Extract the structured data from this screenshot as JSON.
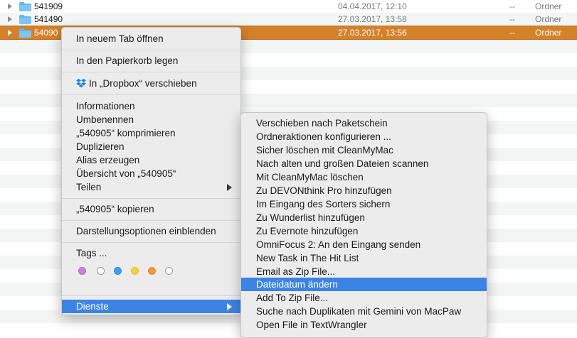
{
  "finder": {
    "rows": [
      {
        "name": "541909",
        "date": "04.04.2017, 12:10",
        "size": "--",
        "kind": "Ordner"
      },
      {
        "name": "541490",
        "date": "27.03.2017, 13:58",
        "size": "--",
        "kind": "Ordner"
      },
      {
        "name": "54090",
        "date": "27.03.2017, 13:56",
        "size": "--",
        "kind": "Ordner"
      }
    ]
  },
  "context_menu": {
    "open_in_tab": "In neuem Tab öffnen",
    "trash": "In den Papierkorb legen",
    "dropbox": "In „Dropbox“ verschieben",
    "info": "Informationen",
    "rename": "Umbenennen",
    "compress": "„540905“ komprimieren",
    "duplicate": "Duplizieren",
    "alias": "Alias erzeugen",
    "overview": "Übersicht von „540905“",
    "share": "Teilen",
    "copy": "„540905“ kopieren",
    "view_options": "Darstellungsoptionen einblenden",
    "tags": "Tags ...",
    "services": "Dienste",
    "tag_colors": [
      "#d07ddf",
      "#ffffff",
      "#3aa2f0",
      "#f8d140",
      "#f69b3b",
      "#ffffff"
    ]
  },
  "services_menu": {
    "items": [
      "Verschieben nach Paketschein",
      "Ordneraktionen konfigurieren ...",
      "Sicher löschen mit CleanMyMac",
      "Nach alten und großen Dateien scannen",
      "Mit CleanMyMac löschen",
      "Zu DEVONthink Pro hinzufügen",
      "Im Eingang des Sorters sichern",
      "Zu Wunderlist hinzufügen",
      "Zu Evernote hinzufügen",
      "OmniFocus 2: An den Eingang senden",
      "New Task in The Hit List",
      "Email as Zip File...",
      "Dateidatum ändern",
      "Add To Zip File...",
      "Suche nach Duplikaten mit Gemini von MacPaw",
      "Open File in TextWrangler"
    ]
  },
  "colors": {
    "selection": "#d4812a",
    "highlight": "#3c84e4",
    "folder": "#5fb4f0"
  }
}
